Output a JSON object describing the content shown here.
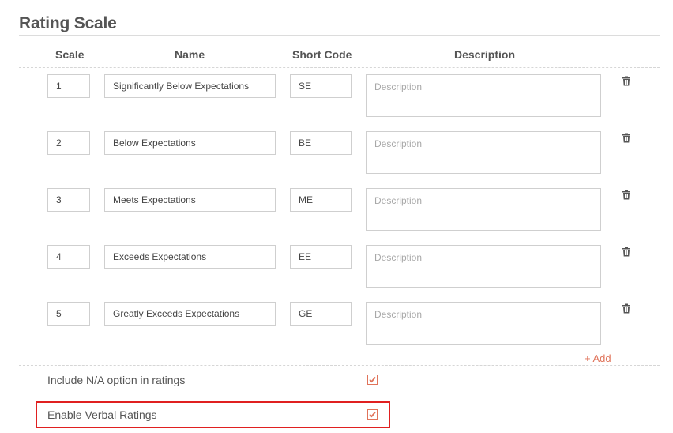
{
  "section": {
    "title": "Rating Scale"
  },
  "columns": {
    "scale": "Scale",
    "name": "Name",
    "short_code": "Short Code",
    "description": "Description"
  },
  "rows": [
    {
      "scale": "1",
      "name": "Significantly Below Expectations",
      "code": "SE",
      "description": "",
      "description_placeholder": "Description"
    },
    {
      "scale": "2",
      "name": "Below Expectations",
      "code": "BE",
      "description": "",
      "description_placeholder": "Description"
    },
    {
      "scale": "3",
      "name": "Meets Expectations",
      "code": "ME",
      "description": "",
      "description_placeholder": "Description"
    },
    {
      "scale": "4",
      "name": "Exceeds Expectations",
      "code": "EE",
      "description": "",
      "description_placeholder": "Description"
    },
    {
      "scale": "5",
      "name": "Greatly Exceeds Expectations",
      "code": "GE",
      "description": "",
      "description_placeholder": "Description"
    }
  ],
  "add_label": "+ Add",
  "options": {
    "include_na": {
      "label": "Include N/A option in ratings",
      "checked": true
    },
    "verbal_ratings": {
      "label": "Enable Verbal Ratings",
      "checked": true
    }
  },
  "colors": {
    "accent": "#e0735a",
    "highlight": "#e02020",
    "text": "#555555",
    "border": "#cfcfcf"
  },
  "icons": {
    "delete": "trash-icon",
    "checked": "checkmark-icon"
  }
}
